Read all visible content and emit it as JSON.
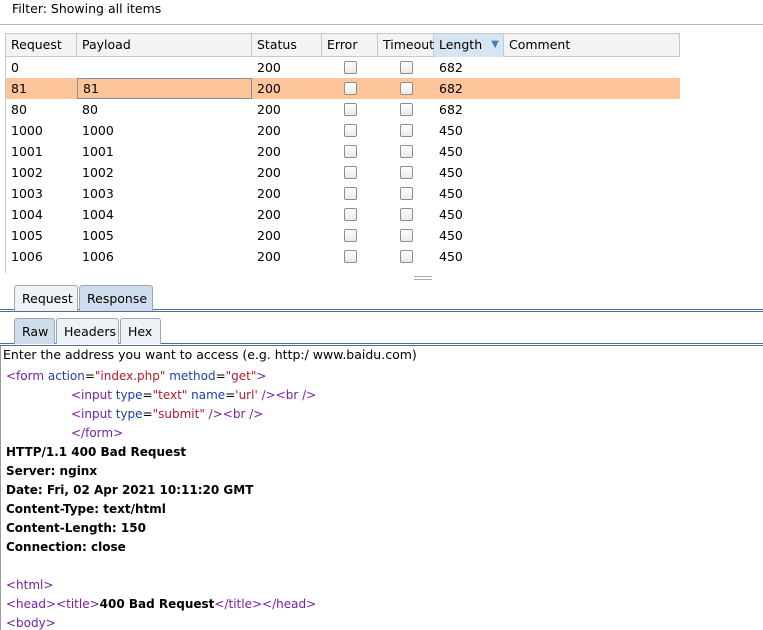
{
  "filter": {
    "text": "Filter: Showing all items"
  },
  "table": {
    "columns": [
      "Request",
      "Payload",
      "Status",
      "Error",
      "Timeout",
      "Length",
      "Comment"
    ],
    "sorted_column": "Length",
    "sort_indicator": "▼",
    "selected_row": 1,
    "rows": [
      {
        "request": "0",
        "payload": "",
        "status": "200",
        "error": false,
        "timeout": false,
        "length": "682",
        "comment": ""
      },
      {
        "request": "81",
        "payload": "81",
        "status": "200",
        "error": false,
        "timeout": false,
        "length": "682",
        "comment": ""
      },
      {
        "request": "80",
        "payload": "80",
        "status": "200",
        "error": false,
        "timeout": false,
        "length": "682",
        "comment": ""
      },
      {
        "request": "1000",
        "payload": "1000",
        "status": "200",
        "error": false,
        "timeout": false,
        "length": "450",
        "comment": ""
      },
      {
        "request": "1001",
        "payload": "1001",
        "status": "200",
        "error": false,
        "timeout": false,
        "length": "450",
        "comment": ""
      },
      {
        "request": "1002",
        "payload": "1002",
        "status": "200",
        "error": false,
        "timeout": false,
        "length": "450",
        "comment": ""
      },
      {
        "request": "1003",
        "payload": "1003",
        "status": "200",
        "error": false,
        "timeout": false,
        "length": "450",
        "comment": ""
      },
      {
        "request": "1004",
        "payload": "1004",
        "status": "200",
        "error": false,
        "timeout": false,
        "length": "450",
        "comment": ""
      },
      {
        "request": "1005",
        "payload": "1005",
        "status": "200",
        "error": false,
        "timeout": false,
        "length": "450",
        "comment": ""
      },
      {
        "request": "1006",
        "payload": "1006",
        "status": "200",
        "error": false,
        "timeout": false,
        "length": "450",
        "comment": ""
      }
    ]
  },
  "outer_tabs": {
    "items": [
      "Request",
      "Response"
    ],
    "active": "Response"
  },
  "inner_tabs": {
    "items": [
      "Raw",
      "Headers",
      "Hex"
    ],
    "active": "Raw"
  },
  "response": {
    "intro": "Enter the address you want to access (e.g. http:/ www.baidu.com)",
    "form_open": {
      "t1": "<form",
      "a1": " action",
      "e1": "=",
      "v1": "\"index.php\"",
      "a2": " method",
      "e2": "=",
      "v2": "\"get\"",
      "t2": ">"
    },
    "input_text": {
      "t1": "<input",
      "a1": " type",
      "e1": "=",
      "v1": "\"text\"",
      "a2": " name",
      "e2": "=",
      "v2": "'url'",
      "t2": " /><br />"
    },
    "input_submit": {
      "t1": "<input",
      "a1": " type",
      "e1": "=",
      "v1": "\"submit\"",
      "t2": " /><br />"
    },
    "form_close": "</form>",
    "headers": [
      "HTTP/1.1 400 Bad Request",
      "Server: nginx",
      "Date: Fri, 02 Apr 2021 10:11:20 GMT",
      "Content-Type: text/html",
      "Content-Length: 150",
      "Connection: close"
    ],
    "html_open": "<html>",
    "head_line": {
      "t1": "<head><title>",
      "text": "400 Bad Request",
      "t2": "</title></head>"
    },
    "body_open": "<body>"
  },
  "colors": {
    "selected_row": "#ffc59a",
    "sorted_header": "#d7e5f3",
    "tag": "#7a1fa2",
    "attr": "#1c3fa8",
    "value": "#b01c2c"
  }
}
